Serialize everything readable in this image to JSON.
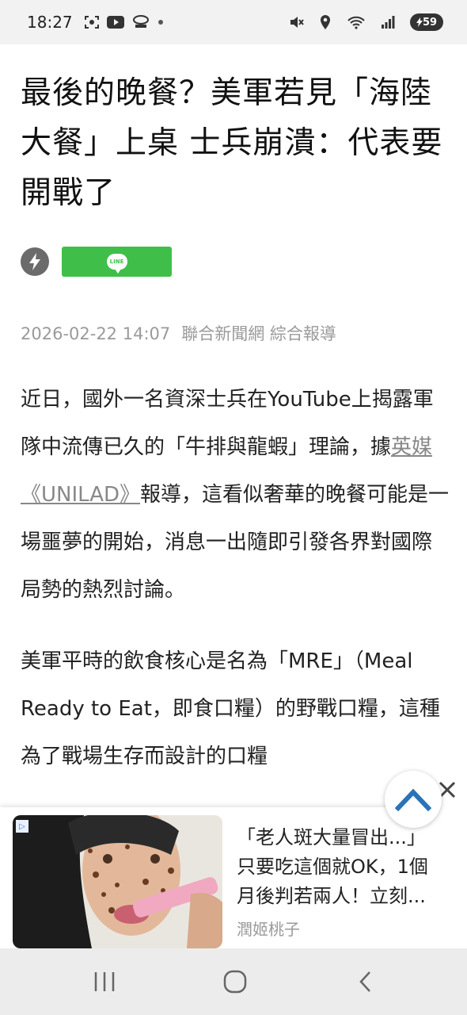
{
  "status_bar": {
    "time": "18:27",
    "left_icons": [
      "screenshot-icon",
      "youtube-icon",
      "skis-icon",
      "dot-icon"
    ],
    "right_icons": [
      "mute-icon",
      "location-icon",
      "wifi-icon",
      "signal-icon"
    ],
    "battery": "59"
  },
  "article": {
    "title": "最後的晚餐？美軍若見「海陸大餐」上桌 士兵崩潰：代表要開戰了",
    "share": {
      "line_label": "LINE"
    },
    "date": "2026-02-22 14:07",
    "source": "聯合新聞網 綜合報導",
    "paragraph1_a": "近日，國外一名資深士兵在YouTube上揭露軍隊中流傳已久的「牛排與龍蝦」理論，據",
    "paragraph1_link": "英媒《UNILAD》",
    "paragraph1_b": "報導，這看似奢華的晚餐可能是一場噩夢的開始，消息一出隨即引發各界對國際局勢的熱烈討論。",
    "paragraph2": "美軍平時的飲食核心是名為「MRE」（Meal Ready to Eat，即食口糧）的野戰口糧，這種為了戰場生存而設計的口糧"
  },
  "ad": {
    "line1": "「老人斑大量冒出...」",
    "line2": "只要吃這個就OK，1個",
    "line3": "月後判若兩人！立刻...",
    "brand": "潤姬桃子",
    "badge": "▷"
  },
  "colors": {
    "line_green": "#3fbf4a",
    "accent_blue": "#2a73b8",
    "meta_gray": "#9a9a9a"
  }
}
